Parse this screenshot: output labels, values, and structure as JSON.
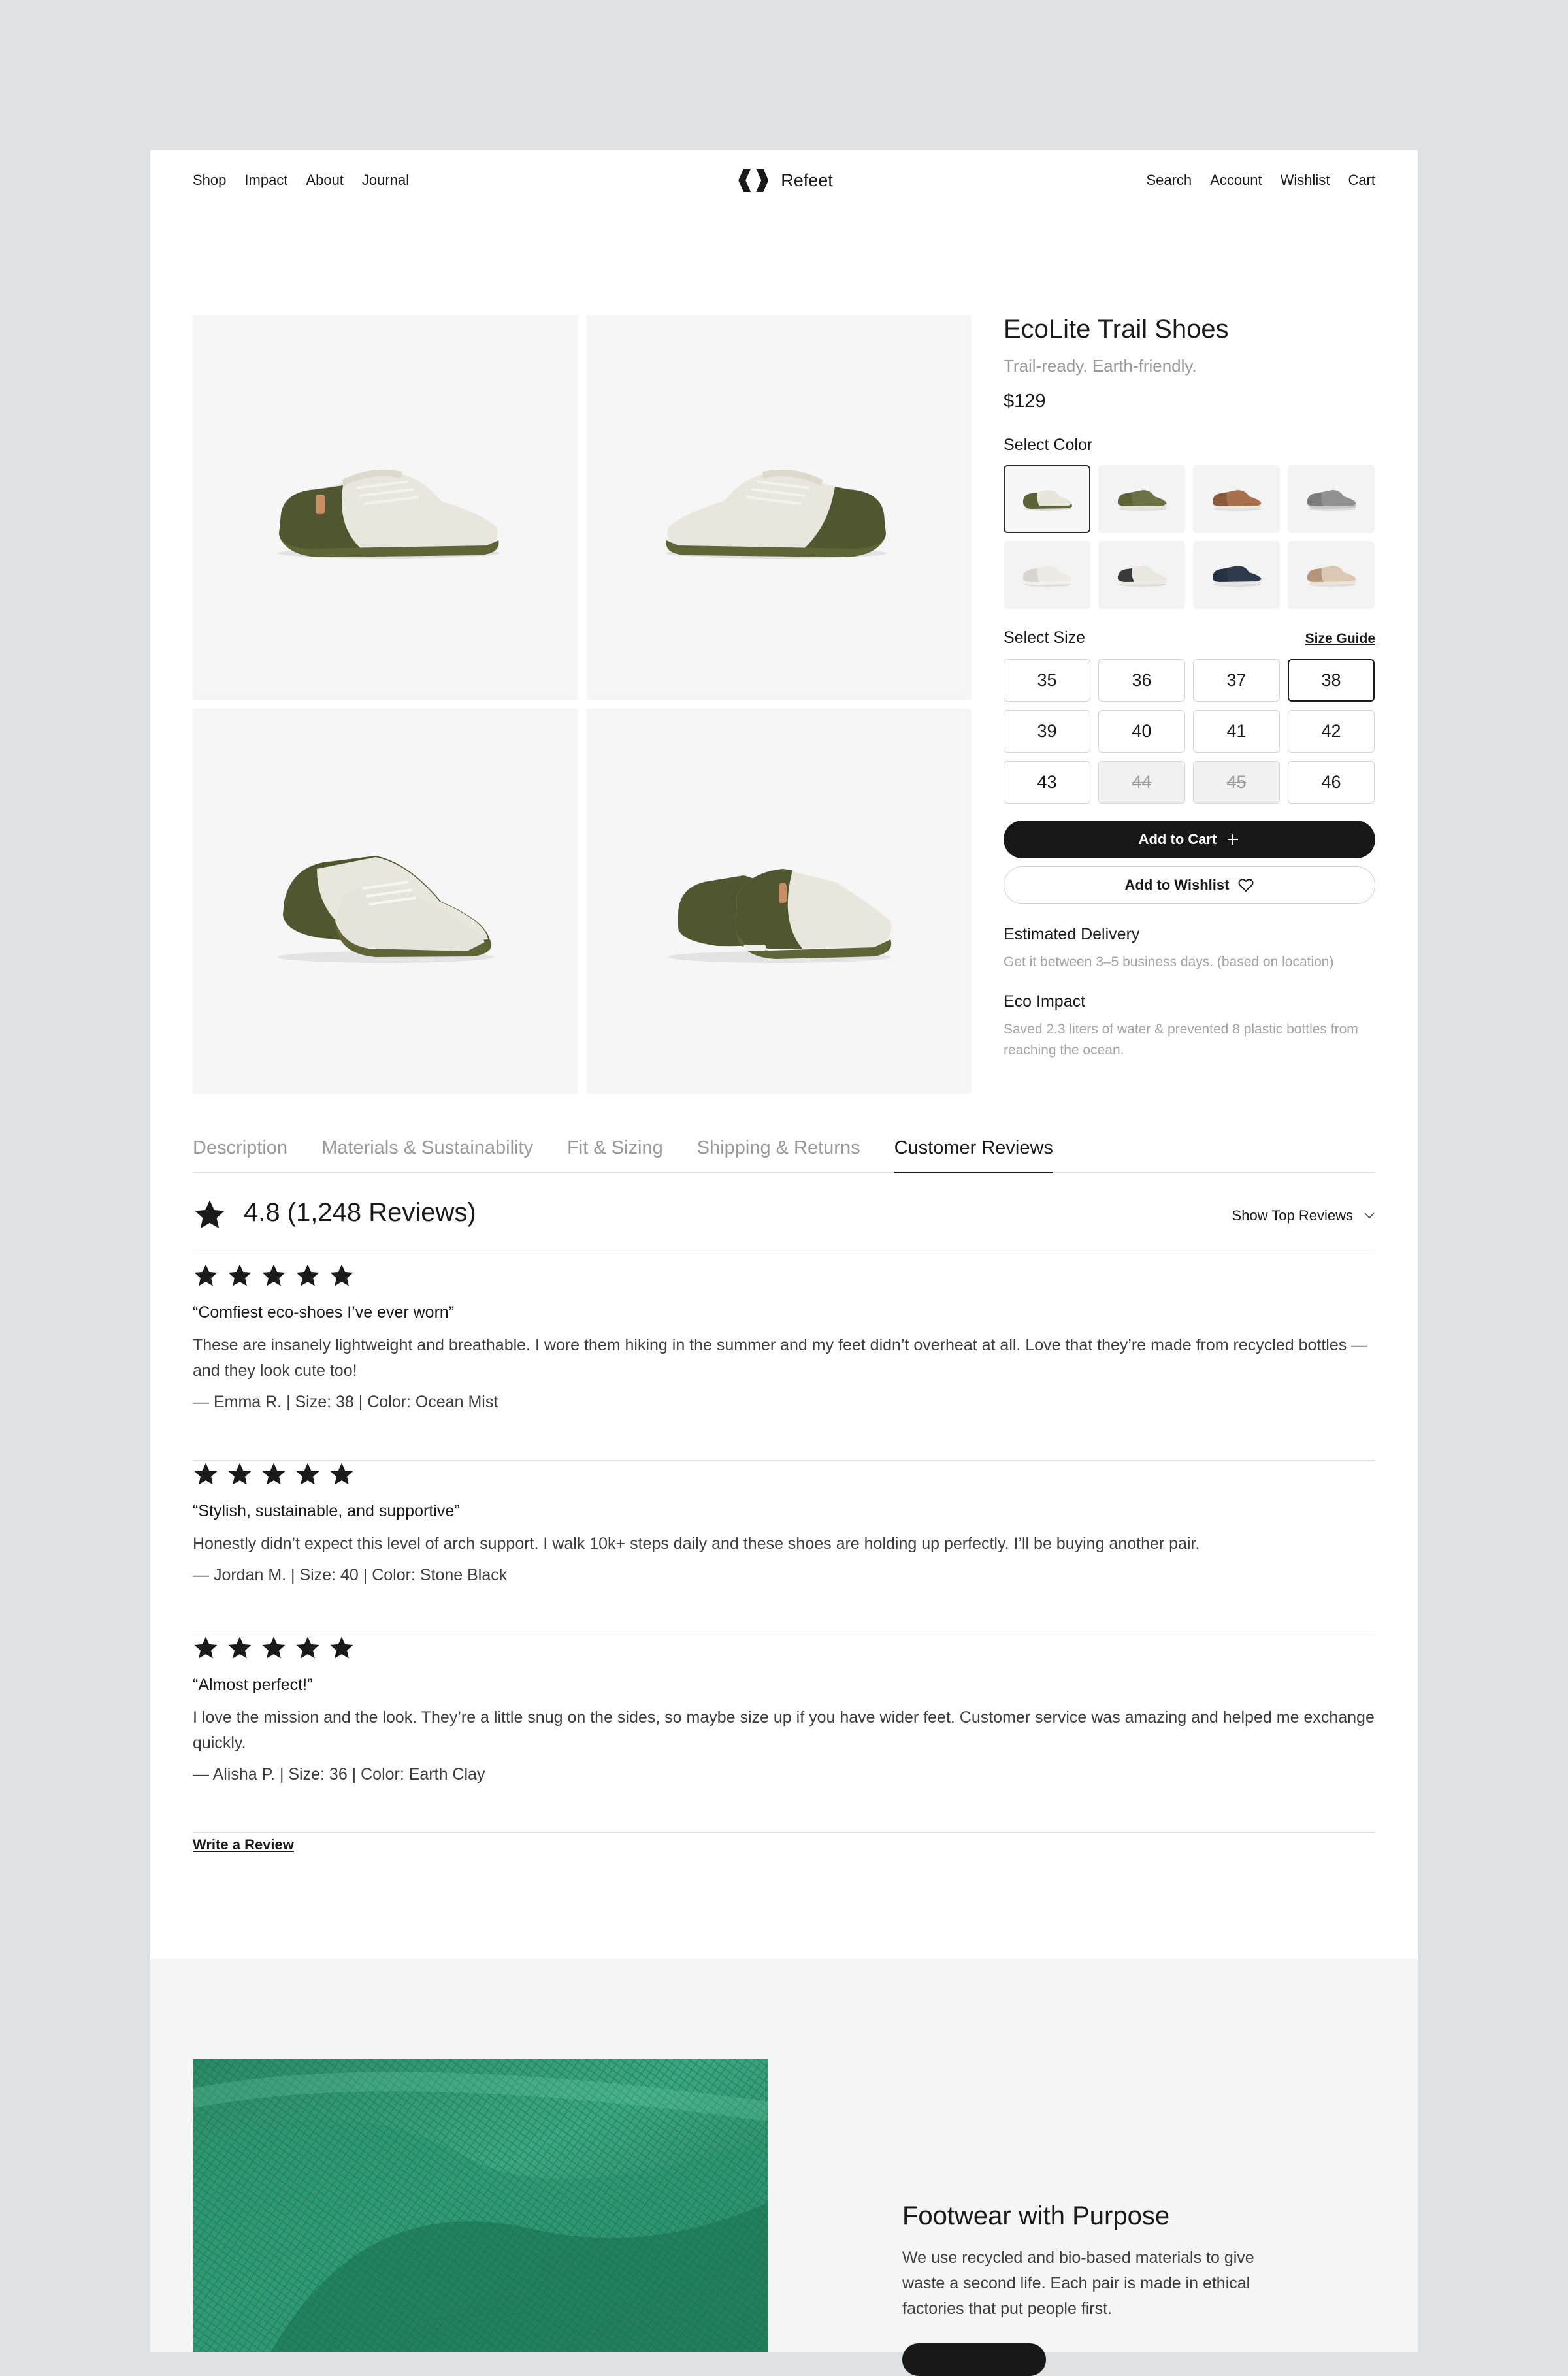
{
  "nav": {
    "left": [
      "Shop",
      "Impact",
      "About",
      "Journal"
    ],
    "brand": "Refeet",
    "right": [
      "Search",
      "Account",
      "Wishlist",
      "Cart"
    ]
  },
  "product": {
    "title": "EcoLite Trail Shoes",
    "subtitle": "Trail-ready. Earth-friendly.",
    "price": "$129",
    "select_color_label": "Select Color",
    "select_size_label": "Select Size",
    "size_guide_label": "Size Guide",
    "colors": [
      {
        "upper": "#e8e5dc",
        "base": "#5b6238",
        "sole": "#5f6537"
      },
      {
        "upper": "#6e7247",
        "base": "#5e6238",
        "sole": "#e8e6dc"
      },
      {
        "upper": "#a86f4d",
        "base": "#8a5a3d",
        "sole": "#ece8df"
      },
      {
        "upper": "#8f9193",
        "base": "#7a7c7e",
        "sole": "#c6c8ca"
      },
      {
        "upper": "#eceae4",
        "base": "#d9d6cf",
        "sole": "#f3f2ee"
      },
      {
        "upper": "#e9e7e0",
        "base": "#3a3a3a",
        "sole": "#eceae3"
      },
      {
        "upper": "#2f3b4d",
        "base": "#263141",
        "sole": "#e7e6e2"
      },
      {
        "upper": "#d9c9b3",
        "base": "#b39579",
        "sole": "#ebe4d8"
      }
    ],
    "sizes": [
      {
        "label": "35",
        "state": "normal"
      },
      {
        "label": "36",
        "state": "normal"
      },
      {
        "label": "37",
        "state": "normal"
      },
      {
        "label": "38",
        "state": "selected"
      },
      {
        "label": "39",
        "state": "normal"
      },
      {
        "label": "40",
        "state": "normal"
      },
      {
        "label": "41",
        "state": "normal"
      },
      {
        "label": "42",
        "state": "normal"
      },
      {
        "label": "43",
        "state": "normal"
      },
      {
        "label": "44",
        "state": "disabled"
      },
      {
        "label": "45",
        "state": "disabled"
      },
      {
        "label": "46",
        "state": "normal"
      }
    ],
    "add_to_cart": "Add to Cart",
    "add_to_wishlist": "Add to Wishlist",
    "delivery_title": "Estimated Delivery",
    "delivery_text": "Get it between 3–5 business days. (based on location)",
    "eco_title": "Eco Impact",
    "eco_text": "Saved 2.3 liters of water & prevented 8 plastic bottles from reaching the ocean."
  },
  "tabs": [
    "Description",
    "Materials & Sustainability",
    "Fit & Sizing",
    "Shipping & Returns",
    "Customer Reviews"
  ],
  "active_tab": 4,
  "reviews": {
    "summary": "4.8 (1,248 Reviews)",
    "sort_label": "Show Top Reviews",
    "items": [
      {
        "stars": 5,
        "headline": "“Comfiest eco-shoes I’ve ever worn”",
        "body": "These are insanely lightweight and breathable. I wore them hiking in the summer and my feet didn’t overheat at all. Love that they’re made from recycled bottles — and they look cute too!",
        "meta": "— Emma R. | Size: 38 | Color: Ocean Mist"
      },
      {
        "stars": 5,
        "headline": "“Stylish, sustainable, and supportive”",
        "body": "Honestly didn’t expect this level of arch support. I walk 10k+ steps daily and these shoes are holding up perfectly. I’ll be buying another pair.",
        "meta": "— Jordan M. | Size: 40 | Color: Stone Black"
      },
      {
        "stars": 5,
        "headline": "“Almost perfect!”",
        "body": "I love the mission and the look. They’re a little snug on the sides, so maybe size up if you have wider feet. Customer service was amazing and helped me exchange quickly.",
        "meta": "— Alisha P. | Size: 36 | Color: Earth Clay"
      }
    ],
    "write_label": "Write a Review"
  },
  "purpose": {
    "title": "Footwear with Purpose",
    "text": "We use recycled and bio-based materials to give waste a second life. Each pair is made in ethical factories that put people first."
  },
  "colors": {
    "ink": "#1a1a1a",
    "muted": "#9a9a9a",
    "olive": "#5f6537",
    "cream": "#e9e6dd",
    "mesh_green": "#2f9a72"
  }
}
